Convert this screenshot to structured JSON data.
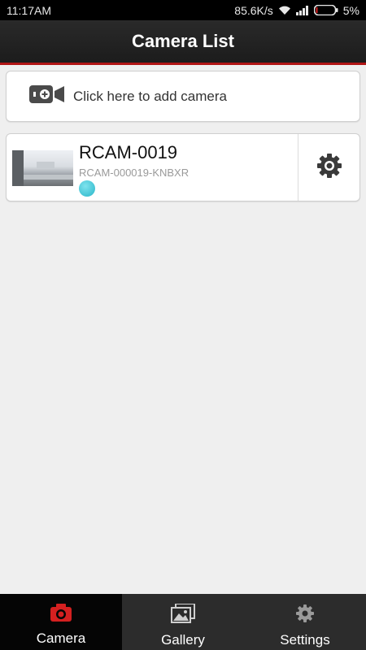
{
  "status_bar": {
    "time": "11:17AM",
    "net_speed": "85.6K/s",
    "battery": "5%"
  },
  "header": {
    "title": "Camera List"
  },
  "add_camera": {
    "label": "Click here to add camera",
    "icon": "add-camera-icon"
  },
  "cameras": [
    {
      "name": "RCAM-0019",
      "id": "RCAM-000019-KNBXR",
      "status_color": "#29b6c9"
    }
  ],
  "bottom_nav": [
    {
      "label": "Camera",
      "icon": "camera-icon",
      "active": true
    },
    {
      "label": "Gallery",
      "icon": "gallery-icon",
      "active": false
    },
    {
      "label": "Settings",
      "icon": "settings-icon",
      "active": false
    }
  ],
  "colors": {
    "accent": "#d42020",
    "header_border": "#b01515"
  }
}
